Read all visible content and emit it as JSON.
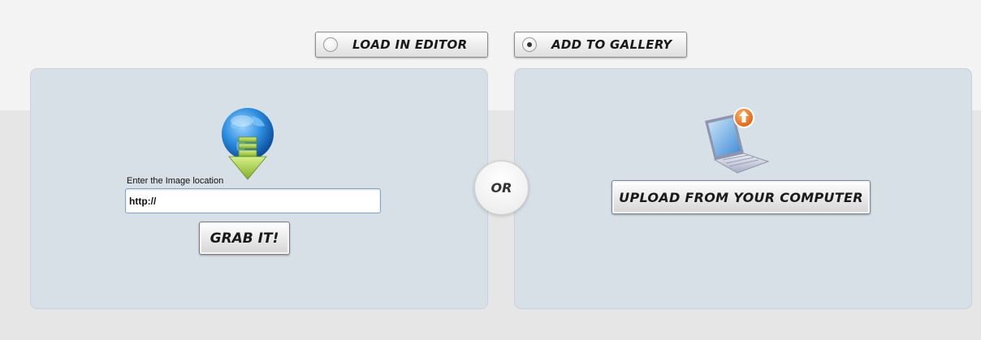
{
  "mode_options": [
    {
      "label": "LOAD IN EDITOR",
      "selected": false
    },
    {
      "label": "ADD TO GALLERY",
      "selected": true
    }
  ],
  "url_panel": {
    "icon": "globe-download-icon",
    "label": "Enter the Image location",
    "input_value": "http://",
    "button_label": "GRAB IT!"
  },
  "divider": {
    "label": "OR"
  },
  "upload_panel": {
    "icon": "laptop-upload-icon",
    "button_label": "UPLOAD FROM YOUR COMPUTER"
  },
  "colors": {
    "panel_bg": "#d6e0e6",
    "page_bg": "#e6e6e6",
    "upload_badge": "#f07a1a",
    "globe_blue": "#2f8fe0",
    "arrow_green": "#8fc23a"
  }
}
